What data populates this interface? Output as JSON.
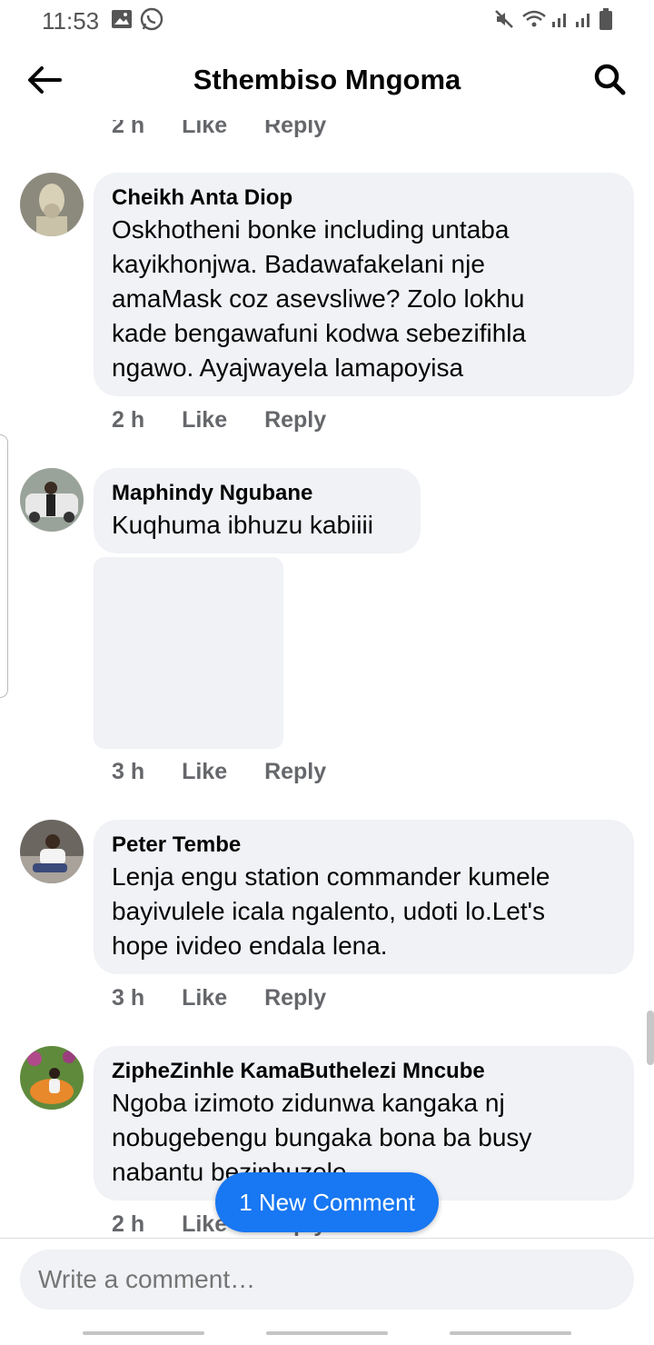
{
  "status": {
    "time": "11:53"
  },
  "header": {
    "title": "Sthembiso Mngoma"
  },
  "top_partial": {
    "time": "2 h",
    "like": "Like",
    "reply": "Reply"
  },
  "comments": [
    {
      "author": "Cheikh Anta Diop",
      "lines": [
        "Oskhotheni bonke including untaba",
        "kayikhonjwa. Badawafakelani nje",
        "amaMask coz asevsliwe? Zolo lokhu",
        "kade bengawafuni kodwa sebezifihla",
        "ngawo. Ayajwayela lamapoyisa"
      ],
      "time": "2 h",
      "like": "Like",
      "reply": "Reply"
    },
    {
      "author": "Maphindy Ngubane",
      "lines": [
        "Kuqhuma ibhuzu kabiiii"
      ],
      "time": "3 h",
      "like": "Like",
      "reply": "Reply"
    },
    {
      "author": "Peter Tembe",
      "lines": [
        "Lenja engu station commander kumele",
        "bayivulele icala ngalento, udoti lo.Let's",
        "hope ivideo endala lena."
      ],
      "time": "3 h",
      "like": "Like",
      "reply": "Reply"
    },
    {
      "author": "ZipheZinhle KamaButhelezi Mncube",
      "lines": [
        "Ngoba izimoto zidunwa kangaka nj",
        "nobugebengu bungaka bona ba busy",
        "nabantu bezinbuzele"
      ],
      "time": "2 h",
      "like": "Like",
      "reply": "Reply"
    }
  ],
  "new_comment_button": "1 New Comment",
  "composer": {
    "placeholder": "Write a comment…"
  },
  "colors": {
    "accent": "#1877f2",
    "bubble": "#f0f2f5",
    "meta": "#65676b"
  }
}
